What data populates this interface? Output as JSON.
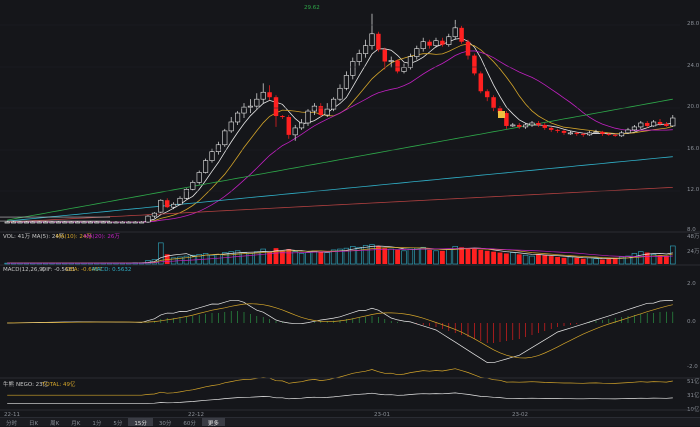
{
  "price_panel": {
    "y_labels": [
      "28.0",
      "24.0",
      "20.0",
      "16.0",
      "12.0",
      "8.0"
    ],
    "peak_label": "29.62"
  },
  "volume_panel": {
    "legend": {
      "vol": "VOL: 41万",
      "ma5": "MA(5): 24万",
      "ma10": "MA(10): 24万",
      "ma20": "MA(20): 26万"
    },
    "y_labels": [
      "48万",
      "24万"
    ]
  },
  "macd_panel": {
    "legend": {
      "name": "MACD(12,26,9)",
      "dif": "DIF: -0.5681",
      "dea": "DEA: -0.6467",
      "macd": "MACD: 0.5632"
    },
    "y_labels": [
      "2.0",
      "0.0",
      "-2.0"
    ]
  },
  "nego_panel": {
    "legend": {
      "name": "牛熊",
      "nego": "NEGO: 23亿",
      "total": "TOTAL: 49亿"
    },
    "y_labels": [
      "51亿",
      "31亿",
      "10亿"
    ]
  },
  "x_labels": [
    "22-11",
    "22-12",
    "23-01",
    "23-02"
  ],
  "bottom_bar": [
    "分时",
    "日K",
    "周K",
    "月K",
    "1分",
    "5分",
    "15分",
    "30分",
    "60分",
    "更多"
  ],
  "colors": {
    "up": "#e8e8e8",
    "down": "#ff2020",
    "ma_yellow": "#d4a52a",
    "ma_magenta": "#c020c0",
    "ma_green": "#2ea84a",
    "ma_cyan": "#30b0c8",
    "ma_red": "#b04040"
  },
  "chart_data": [
    {
      "type": "candlestick",
      "x": [
        "22-11",
        "22-12",
        "23-01",
        "23-02"
      ],
      "ylim": [
        8,
        30
      ],
      "candles": [
        [
          8.6,
          8.6,
          8.5,
          8.7
        ],
        [
          8.6,
          8.6,
          8.5,
          8.7
        ],
        [
          8.6,
          8.6,
          8.5,
          8.7
        ],
        [
          8.6,
          8.6,
          8.5,
          8.7
        ],
        [
          8.6,
          8.6,
          8.5,
          8.7
        ],
        [
          8.6,
          8.6,
          8.5,
          8.7
        ],
        [
          8.6,
          8.6,
          8.5,
          8.7
        ],
        [
          8.6,
          8.6,
          8.5,
          8.7
        ],
        [
          8.6,
          8.6,
          8.5,
          8.7
        ],
        [
          8.6,
          8.6,
          8.5,
          8.7
        ],
        [
          8.6,
          8.6,
          8.5,
          8.7
        ],
        [
          8.6,
          8.6,
          8.5,
          8.7
        ],
        [
          8.6,
          8.6,
          8.5,
          8.7
        ],
        [
          8.6,
          8.6,
          8.5,
          8.7
        ],
        [
          8.6,
          8.6,
          8.5,
          8.7
        ],
        [
          8.6,
          8.6,
          8.5,
          8.7
        ],
        [
          8.6,
          8.6,
          8.5,
          8.7
        ],
        [
          8.6,
          8.6,
          8.5,
          8.7
        ],
        [
          8.6,
          8.6,
          8.5,
          8.7
        ],
        [
          8.6,
          8.6,
          8.5,
          8.7
        ],
        [
          8.6,
          8.6,
          8.5,
          8.7
        ],
        [
          8.6,
          8.6,
          8.5,
          8.7
        ],
        [
          8.6,
          9.2,
          8.5,
          9.3
        ],
        [
          9.2,
          9.5,
          9.0,
          9.6
        ],
        [
          9.6,
          10.8,
          9.5,
          10.9
        ],
        [
          10.8,
          10.1,
          10.0,
          11.0
        ],
        [
          10.1,
          10.4,
          9.9,
          10.6
        ],
        [
          10.4,
          11.0,
          10.3,
          11.2
        ],
        [
          11.0,
          11.9,
          10.9,
          12.0
        ],
        [
          11.9,
          12.6,
          11.8,
          12.8
        ],
        [
          12.6,
          13.6,
          12.4,
          13.8
        ],
        [
          13.6,
          14.8,
          13.5,
          15.0
        ],
        [
          14.8,
          15.7,
          14.6,
          16.0
        ],
        [
          15.7,
          16.4,
          15.4,
          16.7
        ],
        [
          16.4,
          17.8,
          16.2,
          18.0
        ],
        [
          17.8,
          18.7,
          17.6,
          19.2
        ],
        [
          18.7,
          19.6,
          18.4,
          19.8
        ],
        [
          19.6,
          20.2,
          19.1,
          20.6
        ],
        [
          20.2,
          20.3,
          19.6,
          21.0
        ],
        [
          20.3,
          21.0,
          20.0,
          21.6
        ],
        [
          21.0,
          21.7,
          20.6,
          22.6
        ],
        [
          21.7,
          21.2,
          20.9,
          22.4
        ],
        [
          21.2,
          19.3,
          18.2,
          21.4
        ],
        [
          19.3,
          19.2,
          19.0,
          19.4
        ],
        [
          19.2,
          17.4,
          17.0,
          19.4
        ],
        [
          17.4,
          18.1,
          16.8,
          18.4
        ],
        [
          18.1,
          18.6,
          17.9,
          19.0
        ],
        [
          18.6,
          19.8,
          18.3,
          20.0
        ],
        [
          19.8,
          20.3,
          19.4,
          20.6
        ],
        [
          20.3,
          19.4,
          19.2,
          20.6
        ],
        [
          19.4,
          20.0,
          19.2,
          20.6
        ],
        [
          20.0,
          21.0,
          19.8,
          21.2
        ],
        [
          21.0,
          22.1,
          20.8,
          22.5
        ],
        [
          22.1,
          23.4,
          21.9,
          23.8
        ],
        [
          23.4,
          24.8,
          23.0,
          25.2
        ],
        [
          24.8,
          25.6,
          24.4,
          26.0
        ],
        [
          25.6,
          26.4,
          25.2,
          27.0
        ],
        [
          26.4,
          27.6,
          26.0,
          29.62
        ],
        [
          27.6,
          26.0,
          25.8,
          27.8
        ],
        [
          26.0,
          24.8,
          24.0,
          26.2
        ],
        [
          24.8,
          24.9,
          24.2,
          25.3
        ],
        [
          24.9,
          23.8,
          23.6,
          25.0
        ],
        [
          23.8,
          24.2,
          23.6,
          24.6
        ],
        [
          24.2,
          25.3,
          24.0,
          25.6
        ],
        [
          25.3,
          26.1,
          25.0,
          26.4
        ],
        [
          26.1,
          26.8,
          25.8,
          27.2
        ],
        [
          26.8,
          26.4,
          26.1,
          27.0
        ],
        [
          26.4,
          26.9,
          26.2,
          27.2
        ],
        [
          26.9,
          26.5,
          26.3,
          27.2
        ],
        [
          26.5,
          27.3,
          26.3,
          27.6
        ],
        [
          27.3,
          28.2,
          27.0,
          29.0
        ],
        [
          28.2,
          26.8,
          26.6,
          28.4
        ],
        [
          26.8,
          25.4,
          25.0,
          27.0
        ],
        [
          25.4,
          23.6,
          23.4,
          25.6
        ],
        [
          23.6,
          21.8,
          21.6,
          23.8
        ],
        [
          21.8,
          21.2,
          20.8,
          22.0
        ],
        [
          21.2,
          20.1,
          19.8,
          21.4
        ],
        [
          20.1,
          19.6,
          19.4,
          20.3
        ],
        [
          19.6,
          18.3,
          18.0,
          19.8
        ],
        [
          18.3,
          18.4,
          18.2,
          18.6
        ],
        [
          18.4,
          18.2,
          18.0,
          18.6
        ],
        [
          18.2,
          18.4,
          18.0,
          18.6
        ],
        [
          18.4,
          18.6,
          18.2,
          18.8
        ],
        [
          18.6,
          18.4,
          18.2,
          18.8
        ],
        [
          18.4,
          18.1,
          17.9,
          18.6
        ],
        [
          18.1,
          17.9,
          17.7,
          18.2
        ],
        [
          17.9,
          17.8,
          17.6,
          18.0
        ],
        [
          17.8,
          17.6,
          17.4,
          17.9
        ],
        [
          17.6,
          17.6,
          17.4,
          17.8
        ],
        [
          17.6,
          17.5,
          17.3,
          17.7
        ],
        [
          17.5,
          17.4,
          17.2,
          17.6
        ],
        [
          17.4,
          17.6,
          17.3,
          17.8
        ],
        [
          17.6,
          17.7,
          17.5,
          17.9
        ],
        [
          17.7,
          17.5,
          17.3,
          17.8
        ],
        [
          17.5,
          17.4,
          17.3,
          17.6
        ],
        [
          17.4,
          17.3,
          17.2,
          17.5
        ],
        [
          17.3,
          17.6,
          17.2,
          17.8
        ],
        [
          17.6,
          17.9,
          17.5,
          18.1
        ],
        [
          17.9,
          18.2,
          17.8,
          18.4
        ],
        [
          18.2,
          18.6,
          18.0,
          18.8
        ],
        [
          18.6,
          18.3,
          18.1,
          18.8
        ],
        [
          18.3,
          18.7,
          18.2,
          18.9
        ],
        [
          18.7,
          18.5,
          18.3,
          19.0
        ],
        [
          18.5,
          18.3,
          18.2,
          18.7
        ],
        [
          18.3,
          19.1,
          18.2,
          19.4
        ]
      ],
      "volume": [
        2,
        2,
        2,
        2,
        2,
        2,
        2,
        2,
        2,
        2,
        2,
        2,
        2,
        2,
        2,
        2,
        2,
        2,
        2,
        2,
        3,
        3,
        8,
        10,
        48,
        22,
        14,
        16,
        18,
        20,
        22,
        24,
        20,
        22,
        26,
        28,
        30,
        26,
        24,
        28,
        34,
        28,
        36,
        30,
        34,
        28,
        24,
        26,
        30,
        28,
        26,
        32,
        34,
        36,
        40,
        38,
        42,
        44,
        40,
        36,
        34,
        32,
        30,
        34,
        36,
        38,
        32,
        30,
        30,
        34,
        40,
        38,
        36,
        34,
        32,
        30,
        28,
        26,
        24,
        26,
        22,
        20,
        18,
        22,
        20,
        18,
        16,
        14,
        16,
        14,
        12,
        14,
        12,
        10,
        12,
        14,
        16,
        18,
        24,
        28,
        26,
        22,
        20,
        18,
        41
      ],
      "macd": [
        0,
        0,
        0,
        0,
        0,
        0,
        0,
        0,
        0,
        0,
        0,
        0,
        0,
        0,
        0,
        0,
        0,
        0,
        0,
        0,
        0,
        0,
        0.05,
        0.1,
        0.2,
        0.25,
        0.25,
        0.3,
        0.3,
        0.35,
        0.4,
        0.45,
        0.5,
        0.5,
        0.55,
        0.6,
        0.6,
        0.55,
        0.45,
        0.35,
        0.3,
        0.2,
        0.1,
        0.05,
        0.02,
        0,
        0,
        0.02,
        0.05,
        0.08,
        0.1,
        0.12,
        0.15,
        0.2,
        0.25,
        0.3,
        0.3,
        0.35,
        0.3,
        0.2,
        0.1,
        0.05,
        0.02,
        0.0,
        -0.05,
        -0.1,
        -0.15,
        -0.2,
        -0.3,
        -0.4,
        -0.5,
        -0.6,
        -0.7,
        -0.8,
        -0.9,
        -1.0,
        -1.0,
        -0.95,
        -0.9,
        -0.85,
        -0.8,
        -0.7,
        -0.6,
        -0.5,
        -0.4,
        -0.3,
        -0.2,
        -0.15,
        -0.1,
        -0.05,
        0.0,
        0.05,
        0.1,
        0.15,
        0.2,
        0.25,
        0.3,
        0.35,
        0.4,
        0.45,
        0.5,
        0.5,
        0.55,
        0.56,
        0.56
      ]
    }
  ]
}
